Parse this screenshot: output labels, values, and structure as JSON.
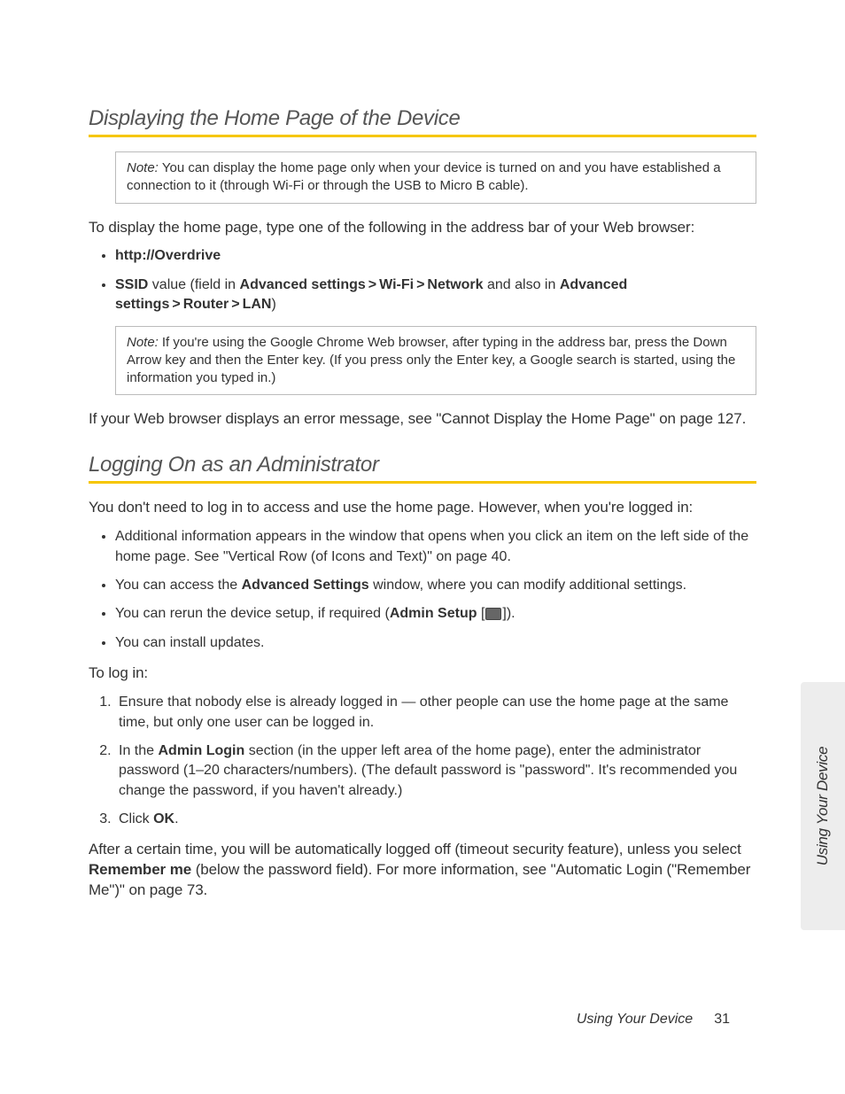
{
  "section1": {
    "heading": "Displaying the Home Page of the Device",
    "note1": {
      "label": "Note:",
      "text": "You can display the home page only when your device is turned on and you have established a connection to it (through Wi-Fi or through the USB to Micro B cable)."
    },
    "intro": "To display the home page, type one of the following in the address bar of your Web browser:",
    "bullet1": "http://Overdrive",
    "bullet2": {
      "a": "SSID",
      "b": " value (field in ",
      "c": "Advanced settings",
      "d": "Wi-Fi",
      "e": "Network",
      "f": " and also in ",
      "g": "Advanced settings",
      "h": "Router",
      "i": "LAN",
      "j": ")"
    },
    "note2": {
      "label": "Note:",
      "text": "If you're using the Google Chrome Web browser, after typing in the address bar, press the Down Arrow key and then the Enter key. (If you press only the Enter key, a Google search is started, using the information you typed in.)"
    },
    "closing": "If your Web browser displays an error message, see \"Cannot Display the Home Page\" on page 127."
  },
  "section2": {
    "heading": "Logging On as an Administrator",
    "intro": "You don't need to log in to access and use the home page. However, when you're logged in:",
    "bullets": {
      "b1": "Additional information appears in the window that opens when you click an item on the left side of the home page. See \"Vertical Row (of Icons and Text)\" on page 40.",
      "b2a": "You can access the ",
      "b2b": "Advanced Settings",
      "b2c": " window, where you can modify additional settings.",
      "b3a": "You can rerun the device setup, if required (",
      "b3b": "Admin Setup",
      "b3c": " [",
      "b3d": "]).",
      "b4": "You can install updates."
    },
    "login_intro": "To log in:",
    "steps": {
      "s1": "Ensure that nobody else is already logged in — other people can use the home page at the same time, but only one user can be logged in.",
      "s2a": "In the ",
      "s2b": "Admin Login",
      "s2c": " section (in the upper left area of the home page), enter the administrator password (1–20 characters/numbers). (The default password is \"password\". It's recommended you change the password, if you haven't already.)",
      "s3a": "Click ",
      "s3b": "OK",
      "s3c": "."
    },
    "closing_a": "After a certain time, you will be automatically logged off (timeout security feature), unless you select ",
    "closing_b": "Remember me",
    "closing_c": " (below the password field). For more information, see \"Automatic Login (\"Remember Me\")\" on page 73."
  },
  "sidetab": "Using Your Device",
  "footer": {
    "text": "Using Your Device",
    "page": "31"
  }
}
